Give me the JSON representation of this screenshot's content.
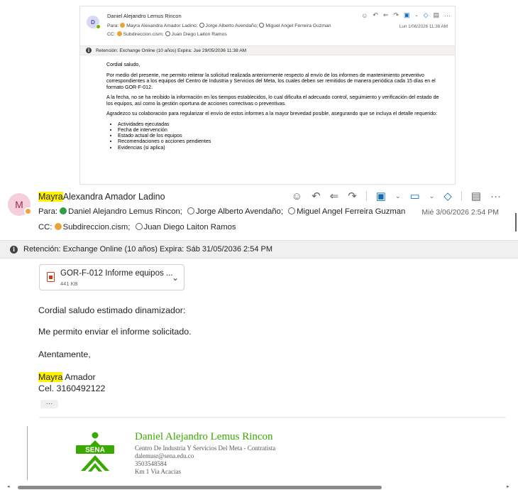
{
  "quoted": {
    "avatar": "D",
    "sender": "Daniel Alejandro Lemus Rincon",
    "to_label": "Para:",
    "to": [
      "Mayra Alexandra Amador Ladino;",
      "Jorge Alberto Avendaño;",
      "Miguel Angel Ferreira Guzman"
    ],
    "cc_label": "CC:",
    "cc": [
      "Subdireccion.cism;",
      "Juan Diego Laiton Ramos"
    ],
    "date": "Lun 1/06/2026 11:38 AM",
    "retention": "Retención: Exchange Online (10 años) Expira: Jue 29/05/2036 11:38 AM",
    "greeting": "Cordial saludo,",
    "para1": "Por medio del presente, me permito reiterar la solicitud realizada anteriormente respecto al envío de los informes de mantenimiento preventivo correspondientes a los equipos del Centro de Industria y Servicios del Meta, los cuales deben ser remitidos de manera periódica cada 15 días en el formato GOR-F-012.",
    "para2": "A la fecha, no se ha recibido la información en los tiempos establecidos, lo cual dificulta el adecuado control, seguimiento y verificación del estado de los equipos, así como la gestión oportuna de acciones correctivas o preventivas.",
    "para3": "Agradezco su colaboración para regularizar el envío de estos informes a la mayor brevedad posible, asegurando que se incluya el detalle requerido:",
    "list": [
      "Actividades ejecutadas",
      "Fecha de intervención",
      "Estado actual de los equipos",
      "Recomendaciones o acciones pendientes",
      "Evidencias (si aplica)"
    ]
  },
  "main": {
    "avatar": "M",
    "sender_highlight": "Mayra",
    "sender_rest": "Alexandra Amador Ladino",
    "to_label": "Para:",
    "to": [
      "Daniel Alejandro Lemus Rincon;",
      "Jorge Alberto Avendaño;",
      "Miguel Angel Ferreira Guzman"
    ],
    "cc_label": "CC:",
    "cc": [
      "Subdireccion.cism;",
      "Juan Diego Laiton Ramos"
    ],
    "date": "Mié 3/06/2026 2:54 PM",
    "retention": "Retención: Exchange Online (10 años) Expira: Sáb 31/05/2036 2:54 PM",
    "attachment": {
      "name": "GOR-F-012 Informe equipos ...",
      "size": "441 KB"
    },
    "body": {
      "greeting": "Cordial saludo estimado dinamizador:",
      "line1": "Me permito enviar el informe solicitado.",
      "closing": "Atentamente,",
      "sign_highlight": "Mayra",
      "sign_rest": " Amador",
      "phone": "Cel. 3160492122"
    },
    "more": "···",
    "signature": {
      "logo_text": "SENA",
      "name": "Daniel Alejandro Lemus Rincon",
      "role": "Centro De Industria Y Servicios Del Meta - Contratista",
      "email": "dalemusr@sena.edu.co",
      "phone": "3503548584",
      "address": "Km 1 Via Acacias"
    }
  },
  "colors": {
    "sena_green": "#39a900",
    "highlight": "#fff100",
    "accent": "#0f6cbd"
  }
}
